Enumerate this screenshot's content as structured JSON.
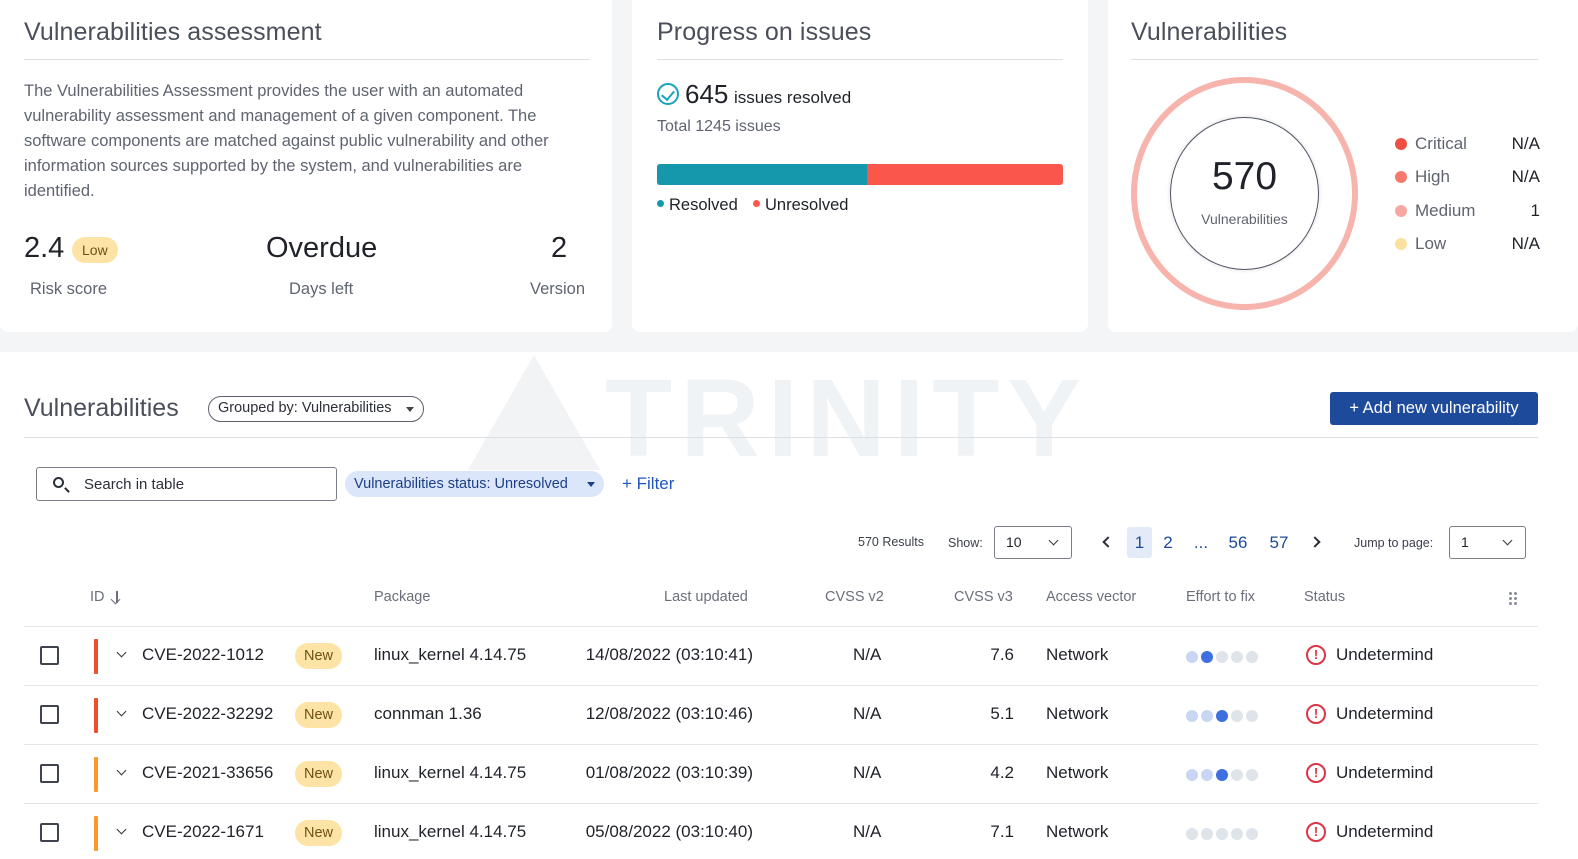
{
  "assessment": {
    "title": "Vulnerabilities assessment",
    "description": "The Vulnerabilities Assessment provides the user with an automated vulnerability assessment and management of a given component. The software components are matched against public vulnerability and other information sources supported by the system, and vulnerabilities are identified.",
    "risk_score": "2.4",
    "risk_level": "Low",
    "risk_label": "Risk score",
    "days_value": "Overdue",
    "days_label": "Days left",
    "version_value": "2",
    "version_label": "Version"
  },
  "progress": {
    "title": "Progress on issues",
    "resolved_count": "645",
    "resolved_label": "issues resolved",
    "total_label": "Total 1245 issues",
    "resolved_fraction": 0.518,
    "legend_resolved": "Resolved",
    "legend_unresolved": "Unresolved",
    "color_resolved": "#1698ac",
    "color_unresolved": "#fb564b"
  },
  "summary": {
    "title": "Vulnerabilities",
    "total": "570",
    "total_label": "Vulnerabilities",
    "severities": [
      {
        "name": "Critical",
        "value": "N/A",
        "color": "#f04e44"
      },
      {
        "name": "High",
        "value": "N/A",
        "color": "#f7796d"
      },
      {
        "name": "Medium",
        "value": "1",
        "color": "#f6a8a0"
      },
      {
        "name": "Low",
        "value": "N/A",
        "color": "#fbe1a0"
      }
    ]
  },
  "watermark": "TRINITY",
  "table_section": {
    "title": "Vulnerabilities",
    "grouped_by": "Grouped by: Vulnerabilities",
    "add_button": "+ Add new vulnerability",
    "search_placeholder": "Search in table",
    "status_filter": "Vulnerabilities status: Unresolved",
    "filter_button": "+ Filter",
    "results": "570 Results",
    "show_label": "Show:",
    "show_value": "10",
    "pages": [
      "1",
      "2",
      "...",
      "56",
      "57"
    ],
    "jump_label": "Jump to page:",
    "jump_value": "1",
    "columns": [
      "ID",
      "Package",
      "Last updated",
      "CVSS v2",
      "CVSS v3",
      "Access vector",
      "Effort to fix",
      "Status"
    ],
    "rows": [
      {
        "id": "CVE-2022-1012",
        "badge": "New",
        "package": "linux_kernel 4.14.75",
        "updated": "14/08/2022 (03:10:41)",
        "cvss2": "N/A",
        "cvss3": "7.6",
        "vector": "Network",
        "effort": 2,
        "status": "Undetermind",
        "sev_color": "#f04e2a"
      },
      {
        "id": "CVE-2022-32292",
        "badge": "New",
        "package": "connman 1.36",
        "updated": "12/08/2022 (03:10:46)",
        "cvss2": "N/A",
        "cvss3": "5.1",
        "vector": "Network",
        "effort": 3,
        "status": "Undetermind",
        "sev_color": "#f04e2a"
      },
      {
        "id": "CVE-2021-33656",
        "badge": "New",
        "package": "linux_kernel 4.14.75",
        "updated": "01/08/2022 (03:10:39)",
        "cvss2": "N/A",
        "cvss3": "4.2",
        "vector": "Network",
        "effort": 3,
        "status": "Undetermind",
        "sev_color": "#f79a2a"
      },
      {
        "id": "CVE-2022-1671",
        "badge": "New",
        "package": "linux_kernel 4.14.75",
        "updated": "05/08/2022 (03:10:40)",
        "cvss2": "N/A",
        "cvss3": "7.1",
        "vector": "Network",
        "effort": 0,
        "status": "Undetermind",
        "sev_color": "#f79a2a"
      }
    ]
  }
}
